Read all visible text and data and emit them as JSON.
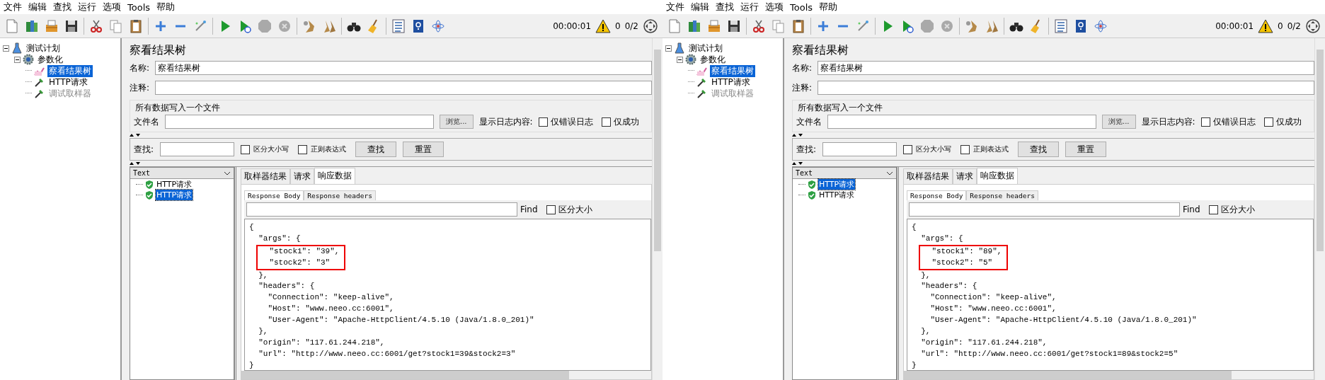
{
  "windows": [
    {
      "menu": [
        "文件",
        "编辑",
        "查找",
        "运行",
        "选项",
        "Tools",
        "帮助"
      ],
      "status": {
        "timer": "00:00:01",
        "errors": "0",
        "threads": "0/2"
      },
      "tree": [
        {
          "label": "测试计划",
          "kind": "plan",
          "selected": false,
          "disabled": false,
          "expanded": true,
          "children": [
            {
              "label": "参数化",
              "kind": "group",
              "selected": false,
              "disabled": false,
              "expanded": true,
              "children": [
                {
                  "label": "察看结果树",
                  "kind": "listener",
                  "selected": true,
                  "disabled": false
                },
                {
                  "label": "HTTP请求",
                  "kind": "sampler",
                  "selected": false,
                  "disabled": false
                },
                {
                  "label": "调试取样器",
                  "kind": "sampler",
                  "selected": false,
                  "disabled": true
                }
              ]
            }
          ]
        }
      ],
      "panel": {
        "title": "察看结果树",
        "name_label": "名称:",
        "name_value": "察看结果树",
        "comment_label": "注释:",
        "file_group": "所有数据写入一个文件",
        "file_label": "文件名",
        "browse_button": "浏览...",
        "log_label": "显示日志内容:",
        "log_options": [
          {
            "label": "仅错误日志",
            "checked": false
          },
          {
            "label": "仅成功",
            "checked": false
          }
        ],
        "search_label": "查找:",
        "search_options": [
          {
            "label": "区分大小写",
            "checked": false
          },
          {
            "label": "正则表达式",
            "checked": false
          }
        ],
        "search_buttons": [
          "查找",
          "重置"
        ]
      },
      "renderer": "Text",
      "results": [
        {
          "label": "HTTP请求",
          "selected": false
        },
        {
          "label": "HTTP请求",
          "selected": true
        }
      ],
      "tabs": [
        {
          "label": "取样器结果",
          "selected": false
        },
        {
          "label": "请求",
          "selected": false
        },
        {
          "label": "响应数据",
          "selected": true
        }
      ],
      "subtabs": [
        {
          "label": "Response Body",
          "selected": true
        },
        {
          "label": "Response headers",
          "selected": false
        }
      ],
      "find": {
        "label": "Find",
        "option": {
          "label": "区分大小",
          "checked": false
        }
      },
      "response": [
        {
          "text": "{",
          "highlighted": false
        },
        {
          "text": "  \"args\": {",
          "highlighted": false
        },
        {
          "text": "    \"stock1\": \"39\",",
          "highlighted": true
        },
        {
          "text": "    \"stock2\": \"3\"",
          "highlighted": true
        },
        {
          "text": "  },",
          "highlighted": false
        },
        {
          "text": "  \"headers\": {",
          "highlighted": false
        },
        {
          "text": "    \"Connection\": \"keep-alive\",",
          "highlighted": false
        },
        {
          "text": "    \"Host\": \"www.neeo.cc:6001\",",
          "highlighted": false
        },
        {
          "text": "    \"User-Agent\": \"Apache-HttpClient/4.5.10 (Java/1.8.0_201)\"",
          "highlighted": false
        },
        {
          "text": "  },",
          "highlighted": false
        },
        {
          "text": "  \"origin\": \"117.61.244.218\",",
          "highlighted": false
        },
        {
          "text": "  \"url\": \"http://www.neeo.cc:6001/get?stock1=39&stock2=3\"",
          "highlighted": false
        },
        {
          "text": "}",
          "highlighted": false
        }
      ]
    },
    {
      "menu": [
        "文件",
        "编辑",
        "查找",
        "运行",
        "选项",
        "Tools",
        "帮助"
      ],
      "status": {
        "timer": "00:00:01",
        "errors": "0",
        "threads": "0/2"
      },
      "tree": [
        {
          "label": "测试计划",
          "kind": "plan",
          "selected": false,
          "disabled": false,
          "expanded": true,
          "children": [
            {
              "label": "参数化",
              "kind": "group",
              "selected": false,
              "disabled": false,
              "expanded": true,
              "children": [
                {
                  "label": "察看结果树",
                  "kind": "listener",
                  "selected": true,
                  "disabled": false
                },
                {
                  "label": "HTTP请求",
                  "kind": "sampler",
                  "selected": false,
                  "disabled": false
                },
                {
                  "label": "调试取样器",
                  "kind": "sampler",
                  "selected": false,
                  "disabled": true
                }
              ]
            }
          ]
        }
      ],
      "panel": {
        "title": "察看结果树",
        "name_label": "名称:",
        "name_value": "察看结果树",
        "comment_label": "注释:",
        "file_group": "所有数据写入一个文件",
        "file_label": "文件名",
        "browse_button": "浏览...",
        "log_label": "显示日志内容:",
        "log_options": [
          {
            "label": "仅错误日志",
            "checked": false
          },
          {
            "label": "仅成功",
            "checked": false
          }
        ],
        "search_label": "查找:",
        "search_options": [
          {
            "label": "区分大小写",
            "checked": false
          },
          {
            "label": "正则表达式",
            "checked": false
          }
        ],
        "search_buttons": [
          "查找",
          "重置"
        ]
      },
      "renderer": "Text",
      "results": [
        {
          "label": "HTTP请求",
          "selected": true
        },
        {
          "label": "HTTP请求",
          "selected": false
        }
      ],
      "tabs": [
        {
          "label": "取样器结果",
          "selected": false
        },
        {
          "label": "请求",
          "selected": false
        },
        {
          "label": "响应数据",
          "selected": true
        }
      ],
      "subtabs": [
        {
          "label": "Response Body",
          "selected": true
        },
        {
          "label": "Response headers",
          "selected": false
        }
      ],
      "find": {
        "label": "Find",
        "option": {
          "label": "区分大小",
          "checked": false
        }
      },
      "response": [
        {
          "text": "{",
          "highlighted": false
        },
        {
          "text": "  \"args\": {",
          "highlighted": false
        },
        {
          "text": "    \"stock1\": \"89\",",
          "highlighted": true
        },
        {
          "text": "    \"stock2\": \"5\"",
          "highlighted": true
        },
        {
          "text": "  },",
          "highlighted": false
        },
        {
          "text": "  \"headers\": {",
          "highlighted": false
        },
        {
          "text": "    \"Connection\": \"keep-alive\",",
          "highlighted": false
        },
        {
          "text": "    \"Host\": \"www.neeo.cc:6001\",",
          "highlighted": false
        },
        {
          "text": "    \"User-Agent\": \"Apache-HttpClient/4.5.10 (Java/1.8.0_201)\"",
          "highlighted": false
        },
        {
          "text": "  },",
          "highlighted": false
        },
        {
          "text": "  \"origin\": \"117.61.244.218\",",
          "highlighted": false
        },
        {
          "text": "  \"url\": \"http://www.neeo.cc:6001/get?stock1=89&stock2=5\"",
          "highlighted": false
        },
        {
          "text": "}",
          "highlighted": false
        }
      ]
    }
  ]
}
